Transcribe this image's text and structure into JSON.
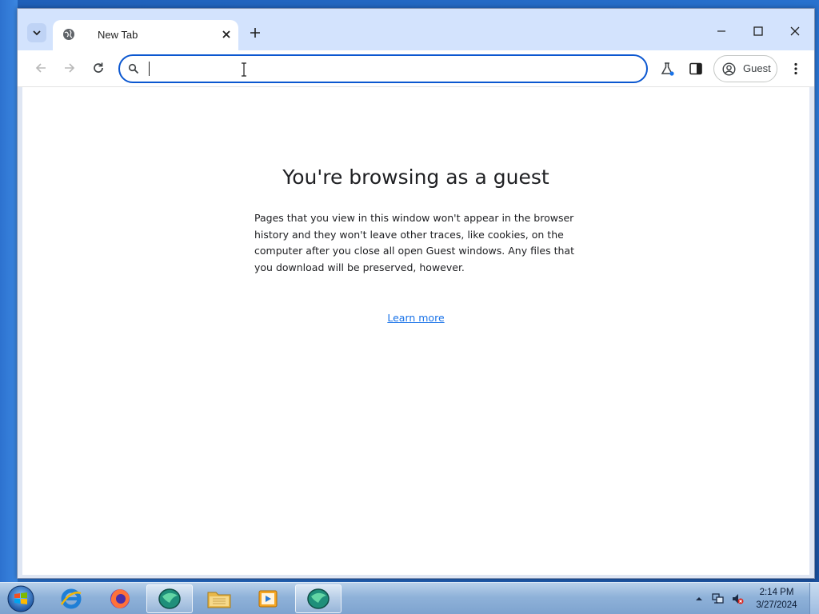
{
  "browser": {
    "tab": {
      "title": "New Tab"
    },
    "omnibox": {
      "value": "",
      "placeholder": ""
    },
    "profile": {
      "label": "Guest"
    }
  },
  "page": {
    "heading": "You're browsing as a guest",
    "body": "Pages that you view in this window won't appear in the browser history and they won't leave other traces, like cookies, on the computer after you close all open Guest windows. Any files that you download will be preserved, however.",
    "learn_more": "Learn more"
  },
  "taskbar": {
    "apps": [
      "internet-explorer",
      "firefox",
      "app-green-orb",
      "file-explorer",
      "media-player",
      "app-green-orb-active"
    ],
    "clock_time": "2:14 PM",
    "clock_date": "3/27/2024"
  },
  "colors": {
    "accent": "#0b57d0",
    "titlebar": "#d3e3fd",
    "link": "#1a73e8"
  }
}
